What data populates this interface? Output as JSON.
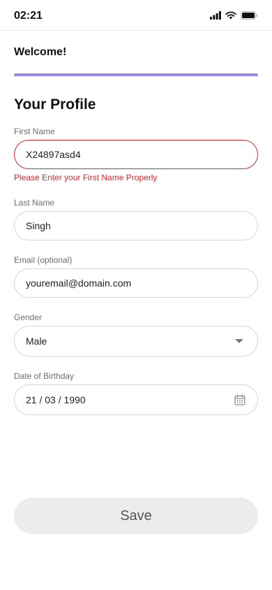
{
  "status_bar": {
    "time": "02:21",
    "icons": [
      "signal-icon",
      "wifi-icon",
      "battery-icon"
    ]
  },
  "header": {
    "title": "Welcome!",
    "progress_percent": 100,
    "progress_color": "#9b87f5"
  },
  "form": {
    "title": "Your Profile",
    "first_name": {
      "label": "First Name",
      "value": "X24897asd4",
      "error": "Please Enter your First Name Properly"
    },
    "last_name": {
      "label": "Last Name",
      "value": "Singh"
    },
    "email": {
      "label": "Email (optional)",
      "value": "youremail@domain.com"
    },
    "gender": {
      "label": "Gender",
      "value": "Male"
    },
    "birthday": {
      "label": "Date of Birthday",
      "value": "21 / 03 / 1990"
    }
  },
  "actions": {
    "save_label": "Save"
  },
  "colors": {
    "error": "#d9262f",
    "accent": "#9b87f5"
  }
}
